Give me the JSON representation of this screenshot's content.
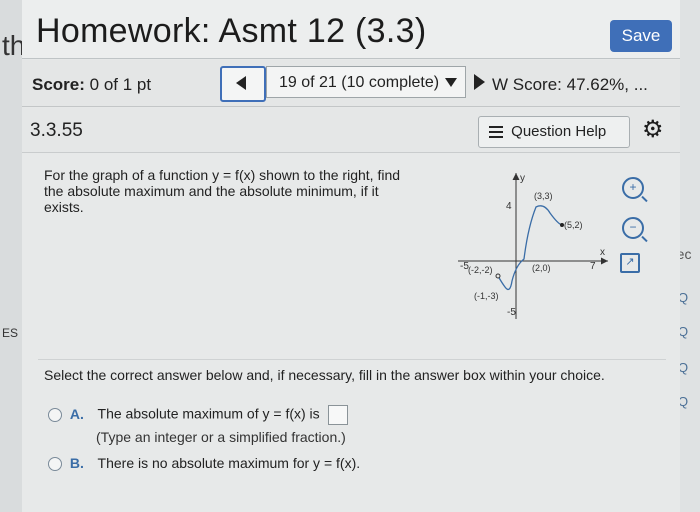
{
  "header": {
    "title": "Homework: Asmt 12 (3.3)",
    "save_label": "Save"
  },
  "scorebar": {
    "score_label": "Score:",
    "score_value": "0 of 1 pt",
    "progress_label": "19 of 21 (10 complete)",
    "hw_score": "W Score: 47.62%, ..."
  },
  "question": {
    "number": "3.3.55",
    "help_label": "Question Help",
    "prompt": "For the graph of a function y = f(x) shown to the right, find the absolute maximum and the absolute minimum, if it exists."
  },
  "graph": {
    "y_label": "y",
    "x_label": "x",
    "tick_labels": {
      "y_top": "4",
      "y_bottom": "-5",
      "x_left": "-5",
      "x_right": "7"
    },
    "points": [
      {
        "label": "(3,3)"
      },
      {
        "label": "(5,2)"
      },
      {
        "label": "(2,0)"
      },
      {
        "label": "(-2,-2)"
      },
      {
        "label": "(-1,-3)"
      }
    ]
  },
  "answer": {
    "instruction": "Select the correct answer below and, if necessary, fill in the answer box within your choice.",
    "option_a_letter": "A.",
    "option_a_text": "The absolute maximum of y = f(x) is",
    "option_a_hint": "(Type an integer or a simplified fraction.)",
    "option_b_letter": "B.",
    "option_b_text": "There is no absolute maximum for y = f(x)."
  },
  "edge_fragments": {
    "left_top": "th",
    "left_mid": "ES",
    "right_rec": "rec",
    "right_q": "Q"
  },
  "colors": {
    "accent": "#3f6fb8",
    "background": "#e6e8e8"
  }
}
